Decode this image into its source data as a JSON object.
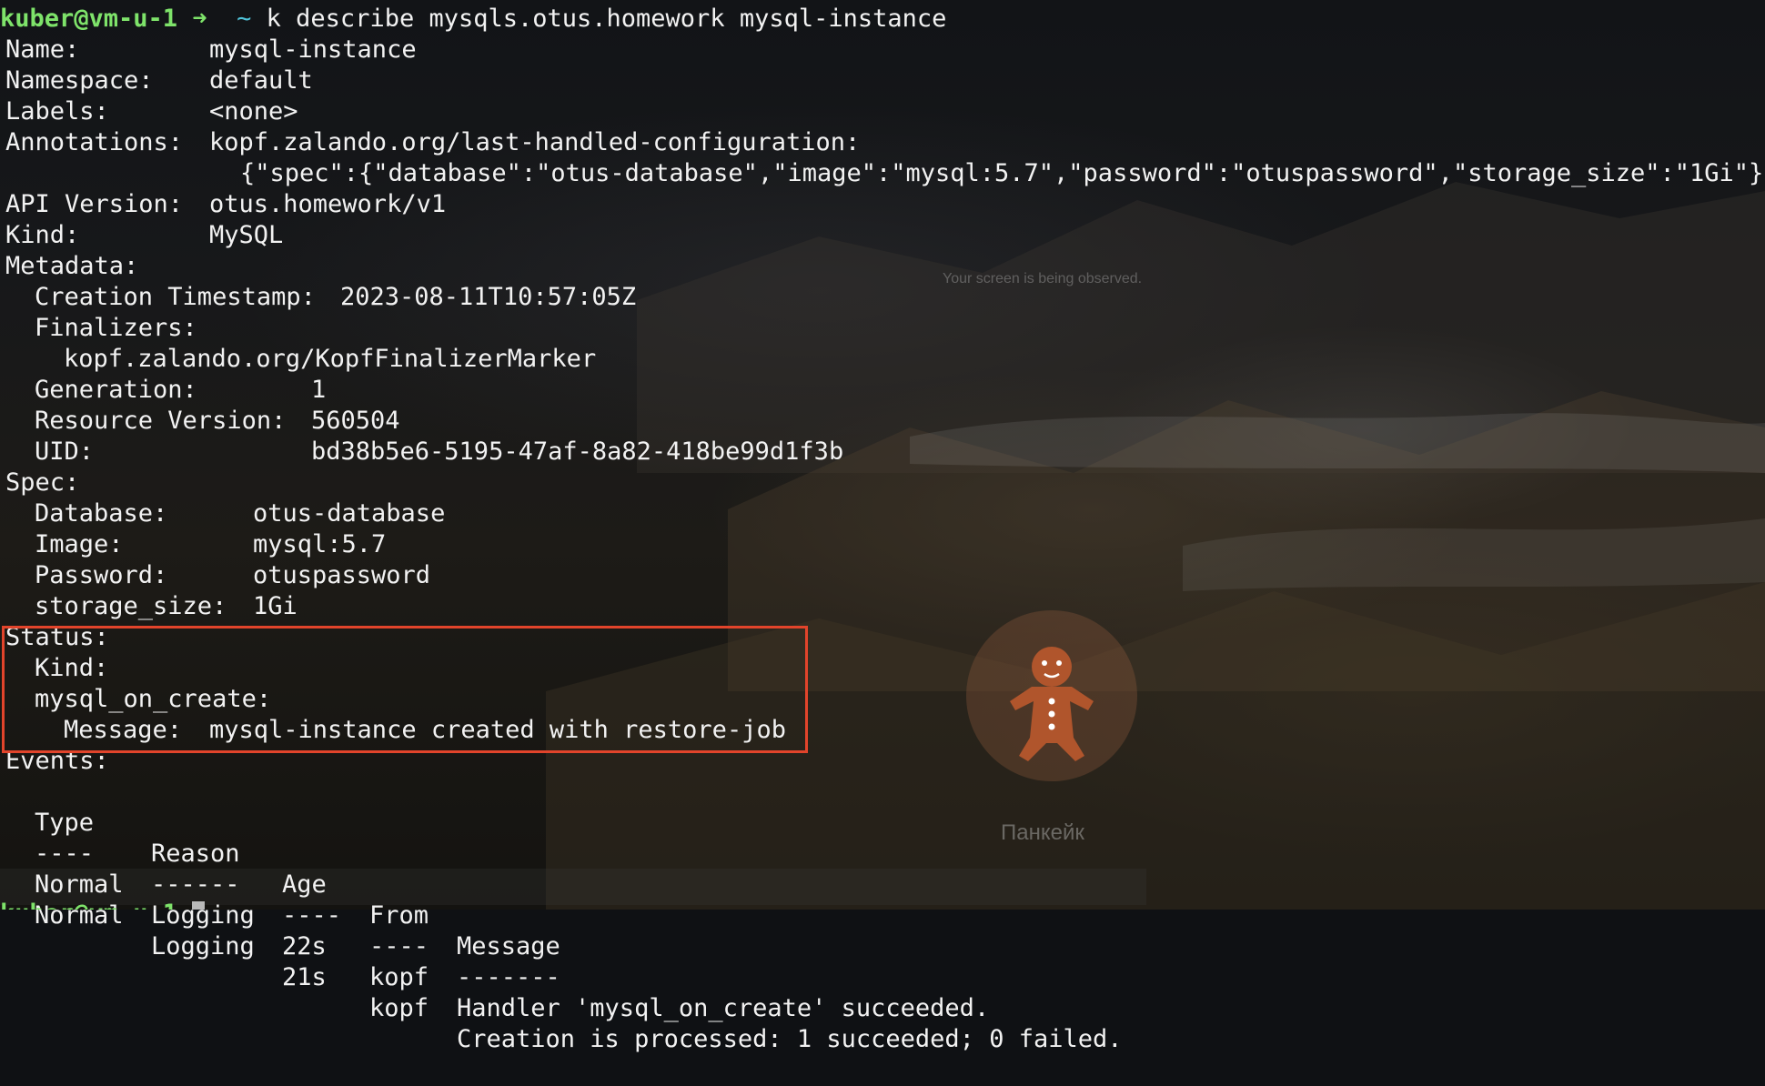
{
  "prompt": {
    "user_host": "kuber@vm-u-1",
    "arrow": "➜",
    "dir": "~",
    "command": "k describe mysqls.otus.homework mysql-instance"
  },
  "describe": {
    "name_key": "Name:",
    "name_val": "mysql-instance",
    "namespace_key": "Namespace:",
    "namespace_val": "default",
    "labels_key": "Labels:",
    "labels_val": "<none>",
    "annotations_key": "Annotations:",
    "annotations_val": "kopf.zalando.org/last-handled-configuration:",
    "annotations_json": "{\"spec\":{\"database\":\"otus-database\",\"image\":\"mysql:5.7\",\"password\":\"otuspassword\",\"storage_size\":\"1Gi\"}}",
    "api_version_key": "API Version:",
    "api_version_val": "otus.homework/v1",
    "kind_key": "Kind:",
    "kind_val": "MySQL",
    "metadata_key": "Metadata:",
    "creation_key": "Creation Timestamp:",
    "creation_val": "2023-08-11T10:57:05Z",
    "finalizers_key": "Finalizers:",
    "finalizer_val": "kopf.zalando.org/KopfFinalizerMarker",
    "generation_key": "Generation:",
    "generation_val": "1",
    "resource_version_key": "Resource Version:",
    "resource_version_val": "560504",
    "uid_key": "UID:",
    "uid_val": "bd38b5e6-5195-47af-8a82-418be99d1f3b",
    "spec_key": "Spec:",
    "database_key": "Database:",
    "database_val": "otus-database",
    "image_key": "Image:",
    "image_val": "mysql:5.7",
    "password_key": "Password:",
    "password_val": "otuspassword",
    "storage_key": "storage_size:",
    "storage_val": "1Gi",
    "status_key": "Status:",
    "status_kind_key": "Kind:",
    "on_create_key": "mysql_on_create:",
    "message_key": "Message:",
    "message_val": "mysql-instance created with restore-job",
    "events_key": "Events:"
  },
  "events": {
    "headers": [
      "Type",
      "Reason",
      "Age",
      "From",
      "Message"
    ],
    "separators": [
      "----",
      "------",
      "----",
      "----",
      "-------"
    ],
    "rows": [
      [
        "Normal",
        "Logging",
        "22s",
        "kopf",
        "Handler 'mysql_on_create' succeeded."
      ],
      [
        "Normal",
        "Logging",
        "21s",
        "kopf",
        "Creation is processed: 1 succeeded; 0 failed."
      ]
    ]
  },
  "next_prompt": "kuber@vm-u-1",
  "overlay": {
    "notice": "Your screen is being observed.",
    "participant_name": "Панкейк",
    "avatar_icon": "gingerbread-man-icon"
  },
  "colors": {
    "highlight": "#e2442b",
    "prompt_green": "#7ee36a",
    "prompt_cyan": "#4fc3d9"
  }
}
